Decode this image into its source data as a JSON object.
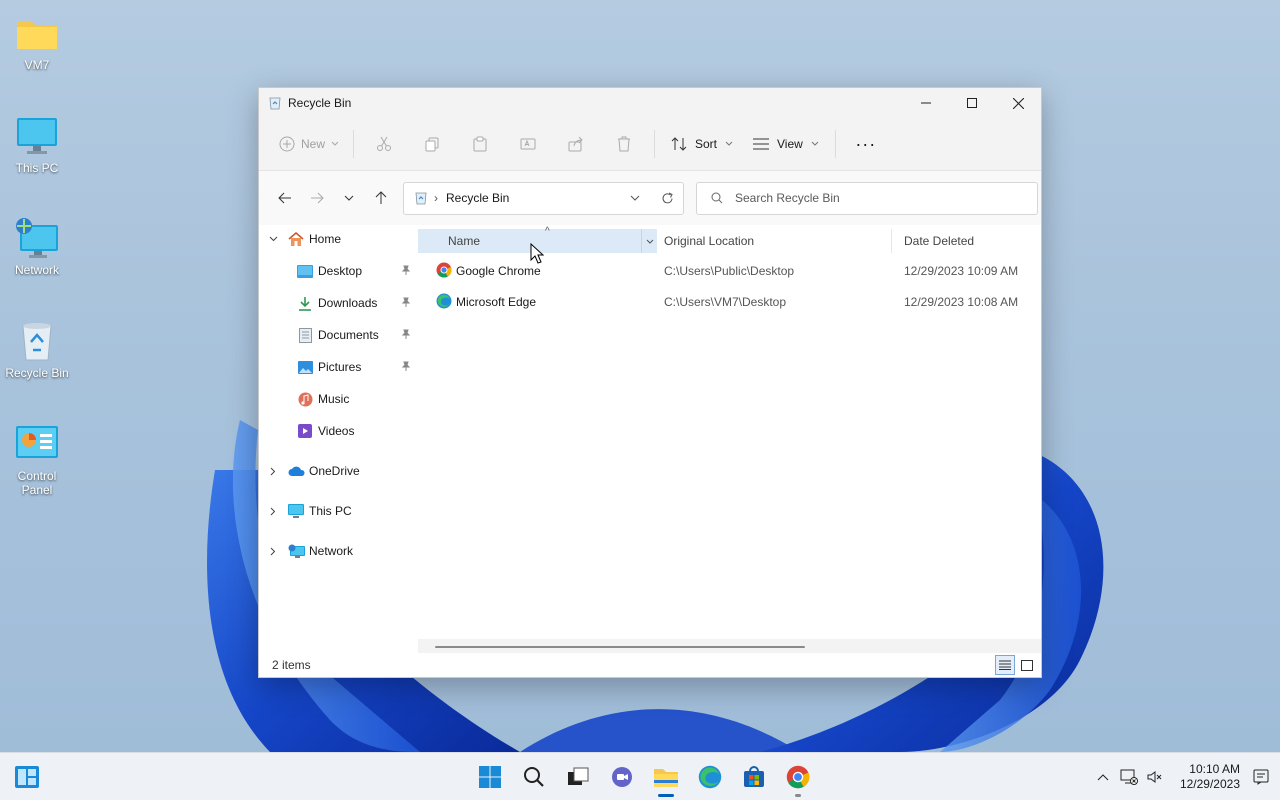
{
  "desktop": {
    "icons": [
      {
        "label": "VM7",
        "icon": "folder-icon"
      },
      {
        "label": "This PC",
        "icon": "monitor-icon"
      },
      {
        "label": "Network",
        "icon": "network-icon"
      },
      {
        "label": "Recycle Bin",
        "icon": "recycle-bin-icon"
      },
      {
        "label": "Control Panel",
        "icon": "control-panel-icon"
      }
    ]
  },
  "window": {
    "title": "Recycle Bin",
    "commands": {
      "new_label": "New",
      "sort_label": "Sort",
      "view_label": "View",
      "more_label": "···"
    },
    "address": {
      "crumb": "Recycle Bin"
    },
    "search": {
      "placeholder": "Search Recycle Bin"
    },
    "sidebar": {
      "home": "Home",
      "quick_access": [
        {
          "label": "Desktop",
          "icon": "desktop-icon",
          "pinned": true
        },
        {
          "label": "Downloads",
          "icon": "downloads-icon",
          "pinned": true
        },
        {
          "label": "Documents",
          "icon": "documents-icon",
          "pinned": true
        },
        {
          "label": "Pictures",
          "icon": "pictures-icon",
          "pinned": true
        },
        {
          "label": "Music",
          "icon": "music-icon",
          "pinned": false
        },
        {
          "label": "Videos",
          "icon": "videos-icon",
          "pinned": false
        }
      ],
      "onedrive": "OneDrive",
      "this_pc": "This PC",
      "network": "Network"
    },
    "columns": {
      "name": "Name",
      "original_location": "Original Location",
      "date_deleted": "Date Deleted"
    },
    "files": [
      {
        "name": "Google Chrome",
        "icon": "chrome-icon",
        "original_location": "C:\\Users\\Public\\Desktop",
        "date_deleted": "12/29/2023 10:09 AM"
      },
      {
        "name": "Microsoft Edge",
        "icon": "edge-icon",
        "original_location": "C:\\Users\\VM7\\Desktop",
        "date_deleted": "12/29/2023 10:08 AM"
      }
    ],
    "status": "2 items"
  },
  "taskbar": {
    "apps": [
      "start-icon",
      "search-icon",
      "task-view-icon",
      "chat-icon",
      "file-explorer-icon",
      "edge-icon",
      "store-icon",
      "chrome-icon"
    ],
    "clock_time": "10:10 AM",
    "clock_date": "12/29/2023"
  },
  "colors": {
    "accent": "#005fb8",
    "selected_header": "#dce9f6"
  }
}
